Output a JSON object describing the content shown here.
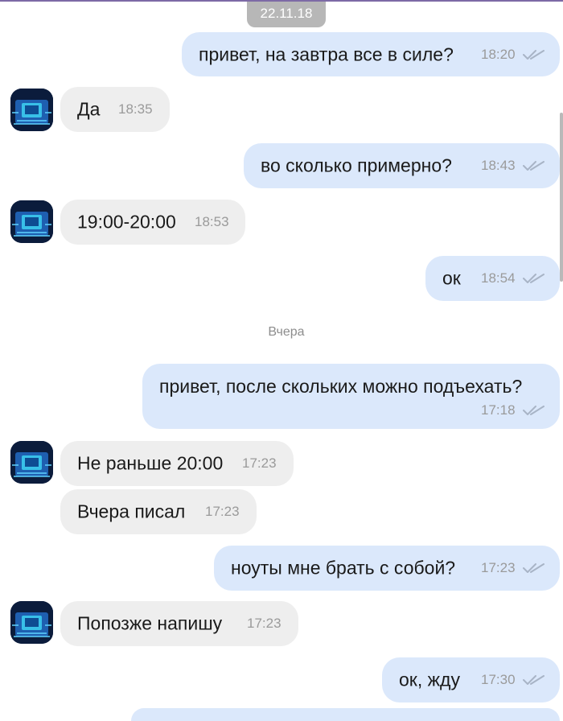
{
  "date_top": "22.11.18",
  "separator_yesterday": "Вчера",
  "messages": [
    {
      "text": "привет, на завтра все в силе?",
      "time": "18:20"
    },
    {
      "text": "Да",
      "time": "18:35"
    },
    {
      "text": "во сколько примерно?",
      "time": "18:43"
    },
    {
      "text": "19:00-20:00",
      "time": "18:53"
    },
    {
      "text": "ок",
      "time": "18:54"
    },
    {
      "text": "привет, после скольких можно подъехать?",
      "time": "17:18"
    },
    {
      "text": "Не раньше 20:00",
      "time": "17:23"
    },
    {
      "text": "Вчера писал",
      "time": "17:23"
    },
    {
      "text": "ноуты мне брать с собой?",
      "time": "17:23"
    },
    {
      "text": "Попозже напишу",
      "time": "17:23"
    },
    {
      "text": "ок, жду",
      "time": "17:30"
    }
  ],
  "colors": {
    "outgoing_bubble": "#dbe8fb",
    "incoming_bubble": "#eeeeee",
    "top_accent": "#7d6aa6",
    "date_chip": "#b7b7b7"
  }
}
